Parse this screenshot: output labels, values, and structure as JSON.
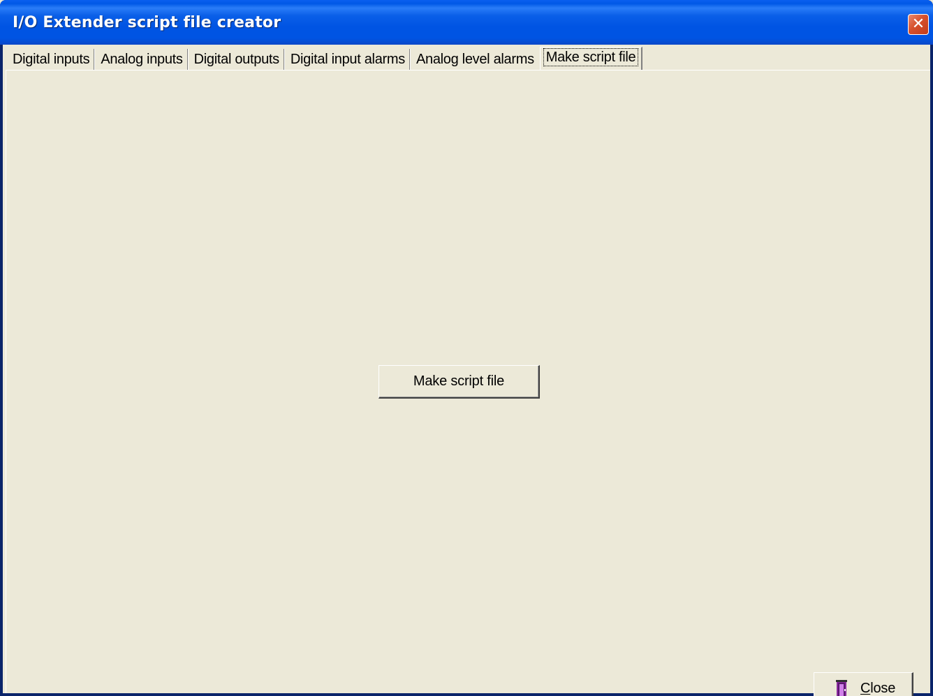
{
  "window": {
    "title": "I/O Extender script file creator",
    "close_glyph": "✕"
  },
  "tabs": [
    {
      "label": "Digital inputs"
    },
    {
      "label": "Analog inputs"
    },
    {
      "label": "Digital outputs"
    },
    {
      "label": "Digital input alarms"
    },
    {
      "label": "Analog level alarms"
    },
    {
      "label": "Make script file",
      "selected": true
    }
  ],
  "main": {
    "make_script_button": "Make script file"
  },
  "footer": {
    "close_button_mnemonic": "C",
    "close_button_rest": "lose",
    "close_icon": "door-exit-icon"
  },
  "colors": {
    "title_bar": "#0054e3",
    "window_background": "#ece9d8",
    "close_button_red": "#d6502c"
  }
}
